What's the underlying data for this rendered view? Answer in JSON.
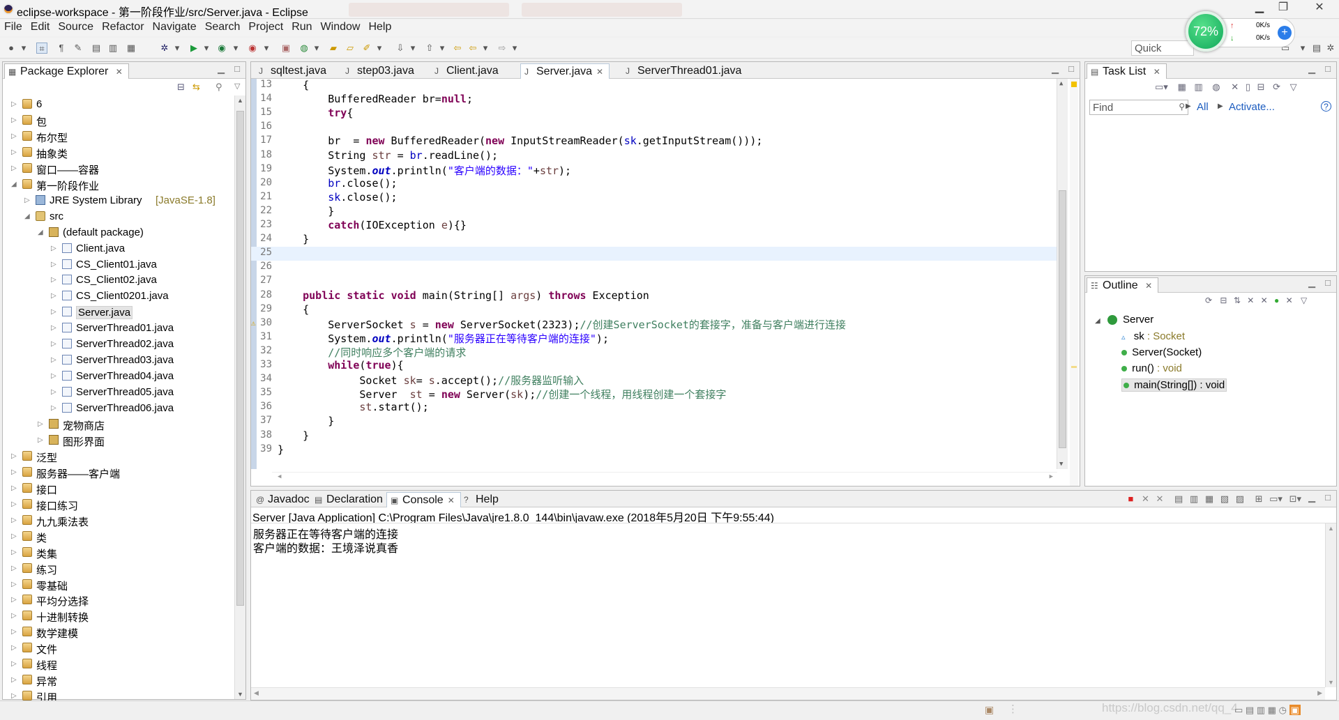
{
  "window": {
    "title": "eclipse-workspace - 第一阶段作业/src/Server.java - Eclipse"
  },
  "menu": [
    "File",
    "Edit",
    "Source",
    "Refactor",
    "Navigate",
    "Search",
    "Project",
    "Run",
    "Window",
    "Help"
  ],
  "quick_access": "Quick Access",
  "monitor": {
    "percent": "72%",
    "up": "0K/s",
    "down": "0K/s"
  },
  "package_explorer": {
    "title": "Package Explorer",
    "items": [
      {
        "label": "6",
        "depth": 0,
        "icon": "project-icon",
        "arrow": "▷"
      },
      {
        "label": "包",
        "depth": 0,
        "icon": "project-icon",
        "arrow": "▷"
      },
      {
        "label": "布尔型",
        "depth": 0,
        "icon": "project-icon",
        "arrow": "▷"
      },
      {
        "label": "抽象类",
        "depth": 0,
        "icon": "project-icon",
        "arrow": "▷"
      },
      {
        "label": "窗口——容器",
        "depth": 0,
        "icon": "project-icon",
        "arrow": "▷"
      },
      {
        "label": "第一阶段作业",
        "depth": 0,
        "icon": "project-icon",
        "arrow": "◢"
      },
      {
        "label": "JRE System Library",
        "extra": "[JavaSE-1.8]",
        "depth": 1,
        "icon": "library-icon",
        "arrow": "▷"
      },
      {
        "label": "src",
        "depth": 1,
        "icon": "source-folder-icon",
        "arrow": "◢"
      },
      {
        "label": "(default package)",
        "depth": 2,
        "icon": "package-icon",
        "arrow": "◢"
      },
      {
        "label": "Client.java",
        "depth": 3,
        "icon": "java-file-icon",
        "arrow": "▷"
      },
      {
        "label": "CS_Client01.java",
        "depth": 3,
        "icon": "java-file-icon",
        "arrow": "▷"
      },
      {
        "label": "CS_Client02.java",
        "depth": 3,
        "icon": "java-file-icon",
        "arrow": "▷"
      },
      {
        "label": "CS_Client0201.java",
        "depth": 3,
        "icon": "java-file-icon",
        "arrow": "▷"
      },
      {
        "label": "Server.java",
        "depth": 3,
        "icon": "java-file-icon",
        "arrow": "▷",
        "selected": true
      },
      {
        "label": "ServerThread01.java",
        "depth": 3,
        "icon": "java-file-icon",
        "arrow": "▷"
      },
      {
        "label": "ServerThread02.java",
        "depth": 3,
        "icon": "java-file-icon",
        "arrow": "▷"
      },
      {
        "label": "ServerThread03.java",
        "depth": 3,
        "icon": "java-file-icon",
        "arrow": "▷"
      },
      {
        "label": "ServerThread04.java",
        "depth": 3,
        "icon": "java-file-icon",
        "arrow": "▷"
      },
      {
        "label": "ServerThread05.java",
        "depth": 3,
        "icon": "java-file-icon",
        "arrow": "▷"
      },
      {
        "label": "ServerThread06.java",
        "depth": 3,
        "icon": "java-file-icon",
        "arrow": "▷"
      },
      {
        "label": "宠物商店",
        "depth": 2,
        "icon": "package-icon",
        "arrow": "▷"
      },
      {
        "label": "图形界面",
        "depth": 2,
        "icon": "package-icon",
        "arrow": "▷"
      },
      {
        "label": "泛型",
        "depth": 0,
        "icon": "project-icon",
        "arrow": "▷"
      },
      {
        "label": "服务器——客户端",
        "depth": 0,
        "icon": "project-icon",
        "arrow": "▷"
      },
      {
        "label": "接口",
        "depth": 0,
        "icon": "project-icon",
        "arrow": "▷"
      },
      {
        "label": "接口练习",
        "depth": 0,
        "icon": "project-icon",
        "arrow": "▷"
      },
      {
        "label": "九九乘法表",
        "depth": 0,
        "icon": "project-icon",
        "arrow": "▷"
      },
      {
        "label": "类",
        "depth": 0,
        "icon": "project-icon",
        "arrow": "▷"
      },
      {
        "label": "类集",
        "depth": 0,
        "icon": "project-icon",
        "arrow": "▷"
      },
      {
        "label": "练习",
        "depth": 0,
        "icon": "project-icon",
        "arrow": "▷"
      },
      {
        "label": "零基础",
        "depth": 0,
        "icon": "project-icon",
        "arrow": "▷"
      },
      {
        "label": "平均分选择",
        "depth": 0,
        "icon": "project-icon",
        "arrow": "▷"
      },
      {
        "label": "十进制转换",
        "depth": 0,
        "icon": "project-icon",
        "arrow": "▷"
      },
      {
        "label": "数学建模",
        "depth": 0,
        "icon": "project-icon",
        "arrow": "▷"
      },
      {
        "label": "文件",
        "depth": 0,
        "icon": "project-icon",
        "arrow": "▷"
      },
      {
        "label": "线程",
        "depth": 0,
        "icon": "project-icon",
        "arrow": "▷"
      },
      {
        "label": "异常",
        "depth": 0,
        "icon": "project-icon",
        "arrow": "▷"
      },
      {
        "label": "引用",
        "depth": 0,
        "icon": "project-icon",
        "arrow": "▷"
      }
    ]
  },
  "editor": {
    "tabs": [
      {
        "label": "sqltest.java",
        "active": false
      },
      {
        "label": "step03.java",
        "active": false
      },
      {
        "label": "Client.java",
        "active": false
      },
      {
        "label": "Server.java",
        "active": true
      },
      {
        "label": "ServerThread01.java",
        "active": false
      }
    ],
    "lines": [
      {
        "n": "13",
        "s": [
          [
            "    {",
            ""
          ]
        ]
      },
      {
        "n": "14",
        "s": [
          [
            "        BufferedReader br=",
            ""
          ],
          [
            "null",
            "kw"
          ],
          [
            ";",
            ""
          ]
        ]
      },
      {
        "n": "15",
        "s": [
          [
            "        ",
            ""
          ],
          [
            "try",
            "kw"
          ],
          [
            "{",
            ""
          ]
        ]
      },
      {
        "n": "16",
        "s": [
          [
            "",
            ""
          ]
        ]
      },
      {
        "n": "17",
        "s": [
          [
            "        br  = ",
            ""
          ],
          [
            "new",
            "kw"
          ],
          [
            " BufferedReader(",
            ""
          ],
          [
            "new",
            "kw"
          ],
          [
            " InputStreamReader(",
            ""
          ],
          [
            "sk",
            "fd"
          ],
          [
            ".getInputStream()));",
            ""
          ]
        ]
      },
      {
        "n": "18",
        "s": [
          [
            "        String ",
            ""
          ],
          [
            "str",
            "lv"
          ],
          [
            " = ",
            ""
          ],
          [
            "br",
            "fd"
          ],
          [
            ".readLine();",
            ""
          ]
        ]
      },
      {
        "n": "19",
        "s": [
          [
            "        System.",
            ""
          ],
          [
            "out",
            "sf"
          ],
          [
            ".println(",
            ""
          ],
          [
            "\"客户端的数据：\"",
            "st"
          ],
          [
            "+",
            ""
          ],
          [
            "str",
            "lv"
          ],
          [
            ");",
            ""
          ]
        ]
      },
      {
        "n": "20",
        "s": [
          [
            "        ",
            ""
          ],
          [
            "br",
            "fd"
          ],
          [
            ".close();",
            ""
          ]
        ]
      },
      {
        "n": "21",
        "s": [
          [
            "        ",
            ""
          ],
          [
            "sk",
            "fd"
          ],
          [
            ".close();",
            ""
          ]
        ]
      },
      {
        "n": "22",
        "s": [
          [
            "        }",
            ""
          ]
        ]
      },
      {
        "n": "23",
        "s": [
          [
            "        ",
            ""
          ],
          [
            "catch",
            "kw"
          ],
          [
            "(IOException ",
            ""
          ],
          [
            "e",
            "lv"
          ],
          [
            "){}",
            ""
          ]
        ]
      },
      {
        "n": "24",
        "s": [
          [
            "    }",
            ""
          ]
        ]
      },
      {
        "n": "25",
        "s": [
          [
            "",
            ""
          ]
        ],
        "hl": true
      },
      {
        "n": "26",
        "s": [
          [
            "",
            ""
          ]
        ]
      },
      {
        "n": "27",
        "s": [
          [
            "",
            ""
          ]
        ]
      },
      {
        "n": "28",
        "s": [
          [
            "    ",
            ""
          ],
          [
            "public",
            "kw"
          ],
          [
            " ",
            ""
          ],
          [
            "static",
            "kw"
          ],
          [
            " ",
            ""
          ],
          [
            "void",
            "kw"
          ],
          [
            " main(String[] ",
            ""
          ],
          [
            "args",
            "lv"
          ],
          [
            ") ",
            ""
          ],
          [
            "throws",
            "kw"
          ],
          [
            " Exception",
            ""
          ]
        ]
      },
      {
        "n": "29",
        "s": [
          [
            "    {",
            ""
          ]
        ]
      },
      {
        "n": "30",
        "s": [
          [
            "        ServerSocket ",
            ""
          ],
          [
            "s",
            "lv"
          ],
          [
            " = ",
            ""
          ],
          [
            "new",
            "kw"
          ],
          [
            " ServerSocket(2323);",
            ""
          ],
          [
            "//创建ServerSocket的套接字，准备与客户端进行连接",
            "cm"
          ]
        ],
        "warn": true
      },
      {
        "n": "31",
        "s": [
          [
            "        System.",
            ""
          ],
          [
            "out",
            "sf"
          ],
          [
            ".println(",
            ""
          ],
          [
            "\"服务器正在等待客户端的连接\"",
            "st"
          ],
          [
            ");",
            ""
          ]
        ]
      },
      {
        "n": "32",
        "s": [
          [
            "        ",
            ""
          ],
          [
            "//同时响应多个客户端的请求",
            "cm"
          ]
        ]
      },
      {
        "n": "33",
        "s": [
          [
            "        ",
            ""
          ],
          [
            "while",
            "kw"
          ],
          [
            "(",
            ""
          ],
          [
            "true",
            "kw"
          ],
          [
            "){",
            ""
          ]
        ]
      },
      {
        "n": "34",
        "s": [
          [
            "             Socket ",
            ""
          ],
          [
            "sk",
            "lv"
          ],
          [
            "= ",
            ""
          ],
          [
            "s",
            "lv"
          ],
          [
            ".accept();",
            ""
          ],
          [
            "//服务器监听输入",
            "cm"
          ]
        ]
      },
      {
        "n": "35",
        "s": [
          [
            "             Server  ",
            ""
          ],
          [
            "st",
            "lv"
          ],
          [
            " = ",
            ""
          ],
          [
            "new",
            "kw"
          ],
          [
            " Server(",
            ""
          ],
          [
            "sk",
            "lv"
          ],
          [
            ");",
            ""
          ],
          [
            "//创建一个线程，用线程创建一个套接字",
            "cm"
          ]
        ]
      },
      {
        "n": "36",
        "s": [
          [
            "             ",
            ""
          ],
          [
            "st",
            "lv"
          ],
          [
            ".start();",
            ""
          ]
        ]
      },
      {
        "n": "37",
        "s": [
          [
            "        }",
            ""
          ]
        ]
      },
      {
        "n": "38",
        "s": [
          [
            "    }",
            ""
          ]
        ]
      },
      {
        "n": "39",
        "s": [
          [
            "}",
            ""
          ]
        ]
      }
    ]
  },
  "task_list": {
    "title": "Task List",
    "find_placeholder": "Find",
    "all_label": "All",
    "activate_label": "Activate..."
  },
  "outline": {
    "title": "Outline",
    "root": "Server",
    "members": [
      {
        "name": "sk",
        "type": " : Socket"
      },
      {
        "name": "Server(Socket)",
        "type": ""
      },
      {
        "name": "run()",
        "type": " : void"
      },
      {
        "name": "main(String[]) : void",
        "type": ""
      }
    ]
  },
  "bottom_tabs": [
    {
      "label": "Javadoc",
      "icon": "@",
      "active": false
    },
    {
      "label": "Declaration",
      "icon": "▤",
      "active": false
    },
    {
      "label": "Console",
      "icon": "▣",
      "active": true
    },
    {
      "label": "Help",
      "icon": "?",
      "active": false
    }
  ],
  "console": {
    "header": "Server [Java Application] C:\\Program Files\\Java\\jre1.8.0_144\\bin\\javaw.exe (2018年5月20日 下午9:55:44)",
    "lines": [
      "服务器正在等待客户端的连接",
      "客户端的数据：王境泽说真香"
    ]
  },
  "watermark": "https://blog.csdn.net/qq_4"
}
